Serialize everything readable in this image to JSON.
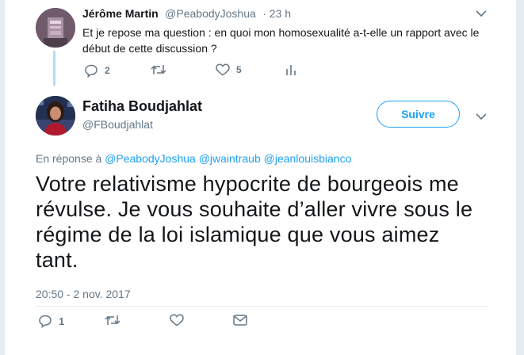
{
  "top_tweet": {
    "author_name": "Jérôme Martin",
    "author_handle": "@PeabodyJoshua",
    "time": "· 23 h",
    "text": "Et je repose ma question : en quoi mon homosexualité a-t-elle un rapport avec le début de cette discussion ?",
    "reply_count": "2",
    "retweet_count": "",
    "like_count": "5"
  },
  "main_tweet": {
    "author_name": "Fatiha Boudjahlat",
    "author_handle": "@FBoudjahlat",
    "follow_label": "Suivre",
    "reply_prefix": "En réponse à",
    "mentions": [
      "@PeabodyJoshua",
      "@jwaintraub",
      "@jeanlouisbianco"
    ],
    "text": "Votre relativisme hypocrite de bourgeois me révulse. Je vous souhaite d’aller vivre sous le régime de la loi islamique que vous aimez tant.",
    "timestamp": "20:50 - 2 nov. 2017",
    "reply_count": "1"
  },
  "colors": {
    "accent": "#1da1f2",
    "muted": "#657786",
    "thread_line": "#b6dbf5",
    "background": "#e6ecf0"
  },
  "icons": [
    "reply-icon",
    "retweet-icon",
    "like-icon",
    "analytics-icon",
    "direct-message-icon",
    "chevron-down-icon"
  ]
}
